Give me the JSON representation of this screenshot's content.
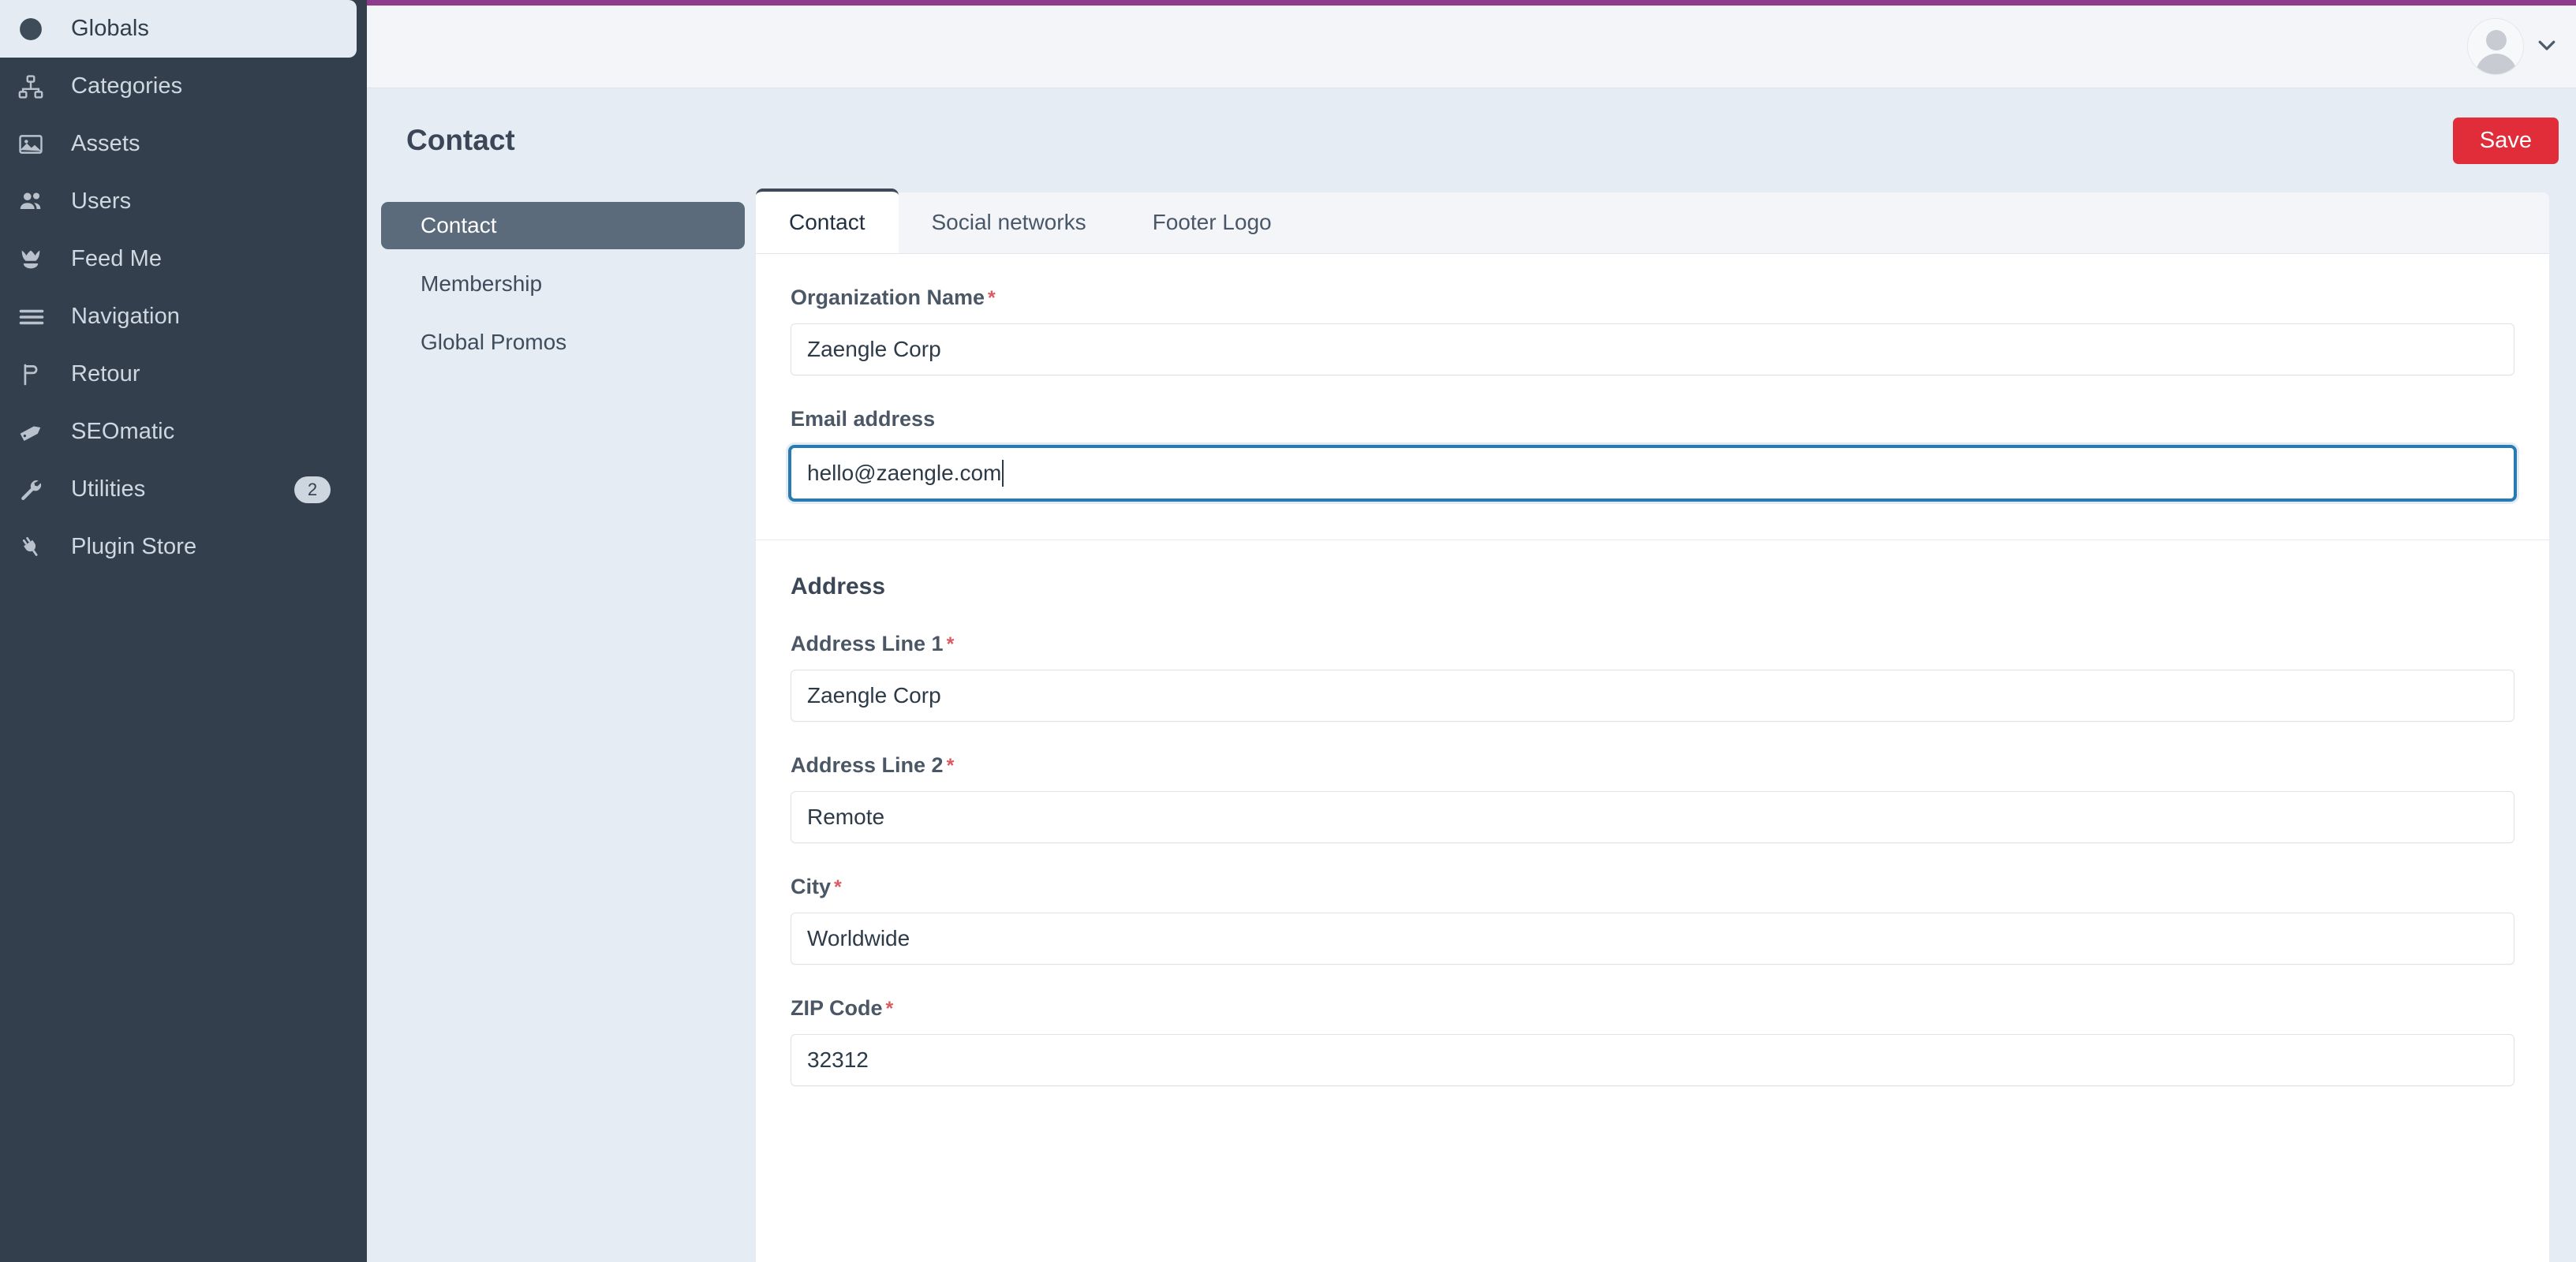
{
  "sidebar": {
    "items": [
      {
        "label": "Globals",
        "icon": "globe-icon",
        "active": true,
        "badge": null
      },
      {
        "label": "Categories",
        "icon": "sitemap-icon",
        "active": false,
        "badge": null
      },
      {
        "label": "Assets",
        "icon": "image-icon",
        "active": false,
        "badge": null
      },
      {
        "label": "Users",
        "icon": "users-icon",
        "active": false,
        "badge": null
      },
      {
        "label": "Feed Me",
        "icon": "feed-me-icon",
        "active": false,
        "badge": null
      },
      {
        "label": "Navigation",
        "icon": "menu-bars-icon",
        "active": false,
        "badge": null
      },
      {
        "label": "Retour",
        "icon": "flag-icon",
        "active": false,
        "badge": null
      },
      {
        "label": "SEOmatic",
        "icon": "seo-tag-icon",
        "active": false,
        "badge": null
      },
      {
        "label": "Utilities",
        "icon": "wrench-icon",
        "active": false,
        "badge": "2"
      },
      {
        "label": "Plugin Store",
        "icon": "plug-icon",
        "active": false,
        "badge": null
      }
    ]
  },
  "topbar": {
    "account_icon": "user-avatar-icon",
    "chevron_icon": "chevron-down-icon"
  },
  "header": {
    "title": "Contact",
    "save_label": "Save"
  },
  "subnav": {
    "items": [
      {
        "label": "Contact",
        "selected": true
      },
      {
        "label": "Membership",
        "selected": false
      },
      {
        "label": "Global Promos",
        "selected": false
      }
    ]
  },
  "tabs": [
    {
      "label": "Contact",
      "active": true
    },
    {
      "label": "Social networks",
      "active": false
    },
    {
      "label": "Footer Logo",
      "active": false
    }
  ],
  "form": {
    "organization_name": {
      "label": "Organization Name",
      "required_marker": "*",
      "value": "Zaengle Corp"
    },
    "email_address": {
      "label": "Email address",
      "required_marker": "",
      "value": "hello@zaengle.com",
      "focused": true
    },
    "address_section_title": "Address",
    "address_line_1": {
      "label": "Address Line 1",
      "required_marker": "*",
      "value": "Zaengle Corp"
    },
    "address_line_2": {
      "label": "Address Line 2",
      "required_marker": "*",
      "value": "Remote"
    },
    "city": {
      "label": "City",
      "required_marker": "*",
      "value": "Worldwide"
    },
    "zip_code": {
      "label": "ZIP Code",
      "required_marker": "*",
      "value": "32312"
    }
  },
  "colors": {
    "sidebar_bg": "#333f4d",
    "accent_bar": "#8e3b8e",
    "save_button": "#e12d39",
    "focus_border": "#2a7ab2",
    "required_star": "#da5a62",
    "subnav_selected": "#5b6b7b"
  }
}
